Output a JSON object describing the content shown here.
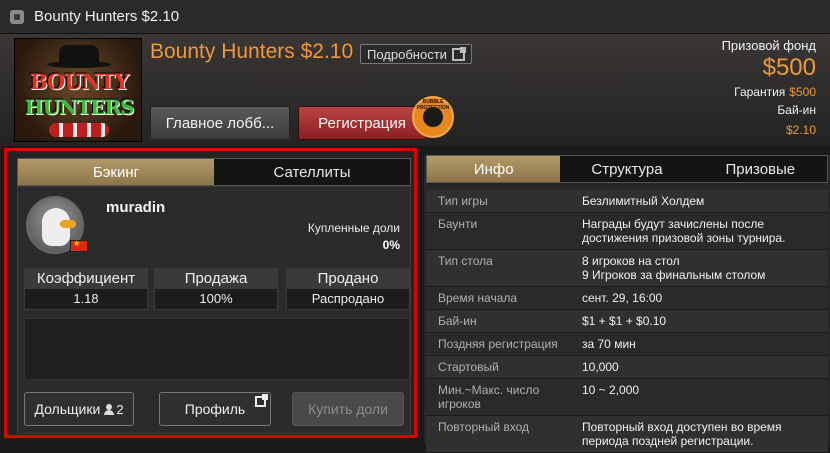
{
  "window": {
    "title": "Bounty Hunters $2.10"
  },
  "header": {
    "logo_line1": "BOUNTY",
    "logo_line2": "HUNTERS",
    "tournament_name": "Bounty Hunters $2.10",
    "details_label": "Подробности",
    "lobby_label": "Главное лобб...",
    "register_label": "Регистрация",
    "bubble_badge": "BUBBLE PROTECTION",
    "prize_pool_label": "Призовой фонд",
    "prize_pool_value": "$500",
    "guarantee_label": "Гарантия",
    "guarantee_value": "$500",
    "buyin_label": "Бай-ин",
    "buyin_value": "$2.10"
  },
  "left_panel": {
    "tabs": [
      {
        "label": "Бэкинг",
        "active": true
      },
      {
        "label": "Сателлиты",
        "active": false
      }
    ],
    "player": {
      "username": "muradin",
      "bought_label": "Купленные доли",
      "bought_value": "0%"
    },
    "stats": [
      {
        "label": "Коэффициент",
        "value": "1.18"
      },
      {
        "label": "Продажа",
        "value": "100%"
      },
      {
        "label": "Продано",
        "value": "Распродано"
      }
    ],
    "buttons": {
      "shareholders_label": "Дольщики",
      "shareholders_count": "2",
      "profile_label": "Профиль",
      "buy_label": "Купить доли"
    }
  },
  "right_panel": {
    "tabs": [
      {
        "label": "Инфо",
        "active": true
      },
      {
        "label": "Структура",
        "active": false
      },
      {
        "label": "Призовые",
        "active": false
      }
    ],
    "rows": [
      {
        "key": "Тип игры",
        "value": "Безлимитный Холдем"
      },
      {
        "key": "Баунти",
        "value": "Награды будут зачислены после достижения призовой зоны турнира."
      },
      {
        "key": "Тип стола",
        "value": "8 игроков на стол\n9 Игроков за финальным столом"
      },
      {
        "key": "Время начала",
        "value": "сент. 29, 16:00"
      },
      {
        "key": "Бай-ин",
        "value": "$1 + $1 + $0.10"
      },
      {
        "key": "Поздняя регистрация",
        "value": "за 70 мин"
      },
      {
        "key": "Стартовый",
        "value": "10,000"
      },
      {
        "key": "Мин.~Макс. число игроков",
        "value": "10 ~ 2,000"
      },
      {
        "key": "Повторный вход",
        "value": "Повторный вход доступен во время периода поздней регистрации."
      }
    ]
  },
  "colors": {
    "accent_orange": "#f0973a",
    "tab_active": "#b39a6a",
    "register_red": "#a83232",
    "highlight_border": "#e00000"
  }
}
